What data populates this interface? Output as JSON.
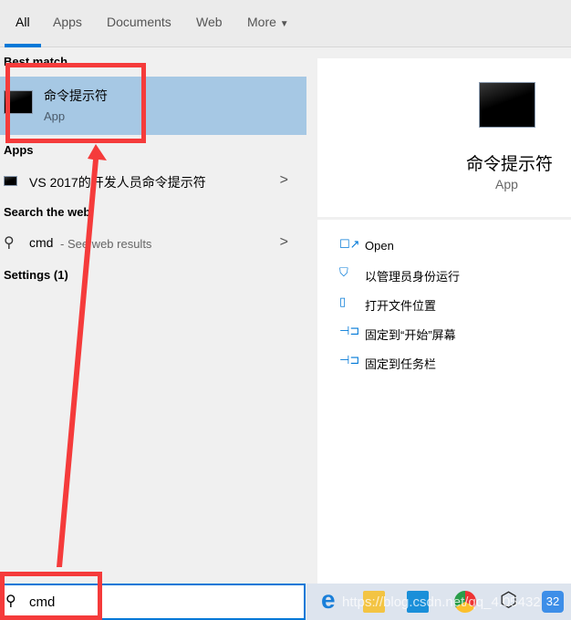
{
  "tabs": [
    {
      "label": "All",
      "active": true
    },
    {
      "label": "Apps"
    },
    {
      "label": "Documents"
    },
    {
      "label": "Web"
    },
    {
      "label": "More"
    }
  ],
  "sections": {
    "best_match": "Best match",
    "apps": "Apps",
    "search_web": "Search the web",
    "settings": "Settings (1)"
  },
  "best_match": {
    "title": "命令提示符",
    "subtitle": "App"
  },
  "apps": [
    {
      "label": "VS 2017的开发人员命令提示符"
    }
  ],
  "web": {
    "query": "cmd",
    "suffix": "- See web results"
  },
  "preview": {
    "title": "命令提示符",
    "subtitle": "App",
    "actions": [
      {
        "icon": "open-icon",
        "label": "Open"
      },
      {
        "icon": "shield-icon",
        "label": "以管理员身份运行"
      },
      {
        "icon": "folder-icon",
        "label": "打开文件位置"
      },
      {
        "icon": "pin-icon",
        "label": "固定到“开始”屏幕"
      },
      {
        "icon": "pin-icon",
        "label": "固定到任务栏"
      }
    ]
  },
  "search": {
    "value": "cmd"
  },
  "taskbar": [
    "edge",
    "file-explorer",
    "mail",
    "chrome",
    "unity",
    "app-32"
  ],
  "taskbar_badge": "32",
  "watermark": "https://blog.csdn.net/qq_4.05432",
  "colors": {
    "accent": "#0078d7",
    "highlight": "#a6c8e4",
    "annotation": "#f53b3b"
  }
}
